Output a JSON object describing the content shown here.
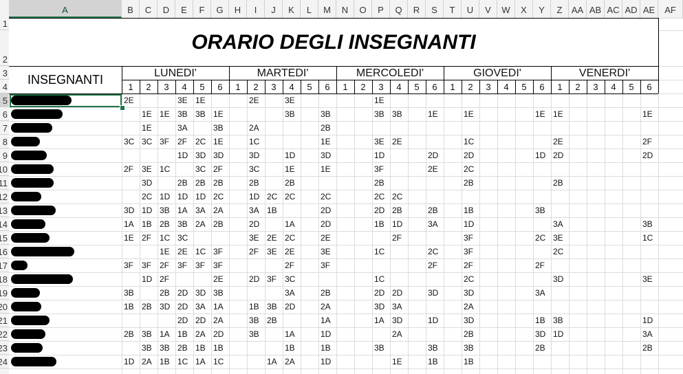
{
  "sheet": {
    "title": "ORARIO DEGLI INSEGNANTI",
    "teacher_header": "INSEGNANTI",
    "days": [
      "LUNEDI'",
      "MARTEDI'",
      "MERCOLEDI'",
      "GIOVEDI'",
      "VENERDI'"
    ],
    "hour_labels": [
      "1",
      "2",
      "3",
      "4",
      "5",
      "6"
    ],
    "columns": [
      "A",
      "B",
      "C",
      "D",
      "E",
      "F",
      "G",
      "H",
      "I",
      "J",
      "K",
      "L",
      "M",
      "N",
      "O",
      "P",
      "Q",
      "R",
      "S",
      "T",
      "U",
      "V",
      "W",
      "X",
      "Y",
      "Z",
      "AA",
      "AB",
      "AC",
      "AD",
      "AE",
      "AF"
    ],
    "row_numbers": [
      "1",
      "2",
      "3",
      "4",
      "5",
      "6",
      "7",
      "8",
      "9",
      "10",
      "11",
      "12",
      "13",
      "14",
      "15",
      "16",
      "17",
      "18",
      "19",
      "20",
      "21",
      "22",
      "23",
      "24"
    ],
    "schedule": [
      [
        "2E",
        "",
        "",
        "3E",
        "1E",
        "",
        "",
        "2E",
        "",
        "3E",
        "",
        "",
        "",
        "",
        "1E",
        "",
        "",
        "",
        "",
        "",
        "",
        "",
        "",
        "",
        "",
        "",
        "",
        "",
        "",
        ""
      ],
      [
        "",
        "1E",
        "1E",
        "3B",
        "3B",
        "1E",
        "",
        "",
        "",
        "3B",
        "",
        "3B",
        "",
        "",
        "3B",
        "3B",
        "",
        "1E",
        "",
        "1E",
        "",
        "",
        "",
        "1E",
        "1E",
        "",
        "",
        "",
        "",
        "1E"
      ],
      [
        "",
        "1E",
        "",
        "3A",
        "",
        "3B",
        "",
        "2A",
        "",
        "",
        "",
        "2B",
        "",
        "",
        "",
        "",
        "",
        "",
        "",
        "",
        "",
        "",
        "",
        "",
        "",
        "",
        "",
        "",
        "",
        ""
      ],
      [
        "3C",
        "3C",
        "3F",
        "2F",
        "2C",
        "1E",
        "",
        "1C",
        "",
        "",
        "",
        "1E",
        "",
        "",
        "3E",
        "2E",
        "",
        "",
        "",
        "1C",
        "",
        "",
        "",
        "",
        "2E",
        "",
        "",
        "",
        "",
        "2F"
      ],
      [
        "",
        "",
        "",
        "1D",
        "3D",
        "3D",
        "",
        "3D",
        "",
        "1D",
        "",
        "3D",
        "",
        "",
        "1D",
        "",
        "",
        "2D",
        "",
        "2D",
        "",
        "",
        "",
        "1D",
        "2D",
        "",
        "",
        "",
        "",
        "2D"
      ],
      [
        "2F",
        "3E",
        "1C",
        "",
        "3C",
        "2F",
        "",
        "3C",
        "",
        "1E",
        "",
        "1E",
        "",
        "",
        "3F",
        "",
        "",
        "2E",
        "",
        "2C",
        "",
        "",
        "",
        "",
        "",
        "",
        "",
        "",
        "",
        ""
      ],
      [
        "",
        "3D",
        "",
        "2B",
        "2B",
        "2B",
        "",
        "2B",
        "",
        "2B",
        "",
        "",
        "",
        "",
        "2B",
        "",
        "",
        "",
        "",
        "2B",
        "",
        "",
        "",
        "",
        "2B",
        "",
        "",
        "",
        "",
        ""
      ],
      [
        "",
        "2C",
        "1D",
        "1D",
        "1D",
        "2C",
        "",
        "1D",
        "2C",
        "2C",
        "",
        "2C",
        "",
        "",
        "2C",
        "2C",
        "",
        "",
        "",
        "",
        "",
        "",
        "",
        "",
        "",
        "",
        "",
        "",
        "",
        ""
      ],
      [
        "3D",
        "1D",
        "3B",
        "1A",
        "3A",
        "2A",
        "",
        "3A",
        "1B",
        "",
        "",
        "2D",
        "",
        "",
        "2D",
        "2B",
        "",
        "2B",
        "",
        "1B",
        "",
        "",
        "",
        "3B",
        "",
        "",
        "",
        "",
        "",
        ""
      ],
      [
        "1A",
        "1B",
        "2B",
        "3B",
        "2A",
        "2B",
        "",
        "2D",
        "",
        "1A",
        "",
        "2D",
        "",
        "",
        "1B",
        "1D",
        "",
        "3A",
        "",
        "1D",
        "",
        "",
        "",
        "",
        "3A",
        "",
        "",
        "",
        "",
        "3B"
      ],
      [
        "1E",
        "2F",
        "1C",
        "3C",
        "",
        "",
        "",
        "3E",
        "2E",
        "2C",
        "",
        "2E",
        "",
        "",
        "",
        "2F",
        "",
        "",
        "",
        "3F",
        "",
        "",
        "",
        "2C",
        "3E",
        "",
        "",
        "",
        "",
        "1C"
      ],
      [
        "",
        "",
        "1E",
        "2E",
        "1C",
        "3F",
        "",
        "2F",
        "3E",
        "2E",
        "",
        "3E",
        "",
        "",
        "1C",
        "",
        "",
        "2C",
        "",
        "3F",
        "",
        "",
        "",
        "",
        "2C",
        "",
        "",
        "",
        "",
        ""
      ],
      [
        "3F",
        "3F",
        "2F",
        "3F",
        "3F",
        "3F",
        "",
        "",
        "",
        "2F",
        "",
        "3F",
        "",
        "",
        "",
        "",
        "",
        "2F",
        "",
        "2F",
        "",
        "",
        "",
        "2F",
        "",
        "",
        "",
        "",
        "",
        ""
      ],
      [
        "",
        "1D",
        "2F",
        "",
        "",
        "2E",
        "",
        "2D",
        "3F",
        "3C",
        "",
        "",
        "",
        "",
        "1C",
        "",
        "",
        "",
        "",
        "2C",
        "",
        "",
        "",
        "",
        "3D",
        "",
        "",
        "",
        "",
        "3E"
      ],
      [
        "3B",
        "",
        "2B",
        "2D",
        "3D",
        "3B",
        "",
        "",
        "",
        "3A",
        "",
        "2B",
        "",
        "",
        "2D",
        "2D",
        "",
        "3D",
        "",
        "3D",
        "",
        "",
        "",
        "3A",
        "",
        "",
        "",
        "",
        "",
        ""
      ],
      [
        "1B",
        "2B",
        "3D",
        "2D",
        "3A",
        "1A",
        "",
        "1B",
        "3B",
        "2D",
        "",
        "2A",
        "",
        "",
        "3D",
        "3A",
        "",
        "",
        "",
        "2A",
        "",
        "",
        "",
        "",
        "",
        "",
        "",
        "",
        "",
        ""
      ],
      [
        "",
        "",
        "",
        "2D",
        "2D",
        "2A",
        "",
        "3B",
        "2B",
        "",
        "",
        "1A",
        "",
        "",
        "1A",
        "3D",
        "",
        "1D",
        "",
        "3D",
        "",
        "",
        "",
        "1B",
        "3B",
        "",
        "",
        "",
        "",
        "1D"
      ],
      [
        "2B",
        "3B",
        "1A",
        "1B",
        "2A",
        "2D",
        "",
        "3B",
        "",
        "1A",
        "",
        "1D",
        "",
        "",
        "",
        "2A",
        "",
        "",
        "",
        "2B",
        "",
        "",
        "",
        "3D",
        "1D",
        "",
        "",
        "",
        "",
        "3A"
      ],
      [
        "",
        "3B",
        "3B",
        "2B",
        "1B",
        "1B",
        "",
        "",
        "",
        "1B",
        "",
        "1B",
        "",
        "",
        "3B",
        "",
        "",
        "3B",
        "",
        "3B",
        "",
        "",
        "",
        "2B",
        "",
        "",
        "",
        "",
        "",
        "2B"
      ],
      [
        "1D",
        "2A",
        "1B",
        "1C",
        "1A",
        "1C",
        "",
        "",
        "1A",
        "2A",
        "",
        "1D",
        "",
        "",
        "",
        "1E",
        "",
        "1B",
        "",
        "1B",
        "",
        "",
        "",
        "",
        "",
        "",
        "",
        "",
        "",
        ""
      ]
    ]
  }
}
